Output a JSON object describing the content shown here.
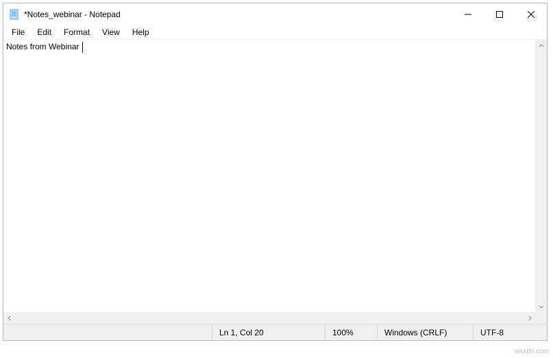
{
  "window": {
    "title": "*Notes_webinar - Notepad"
  },
  "menu": {
    "file": "File",
    "edit": "Edit",
    "format": "Format",
    "view": "View",
    "help": "Help"
  },
  "editor": {
    "content": "Notes from Webinar "
  },
  "status": {
    "cursor": "Ln 1, Col 20",
    "zoom": "100%",
    "eol": "Windows (CRLF)",
    "encoding": "UTF-8"
  },
  "watermark": "wsxdn.com"
}
